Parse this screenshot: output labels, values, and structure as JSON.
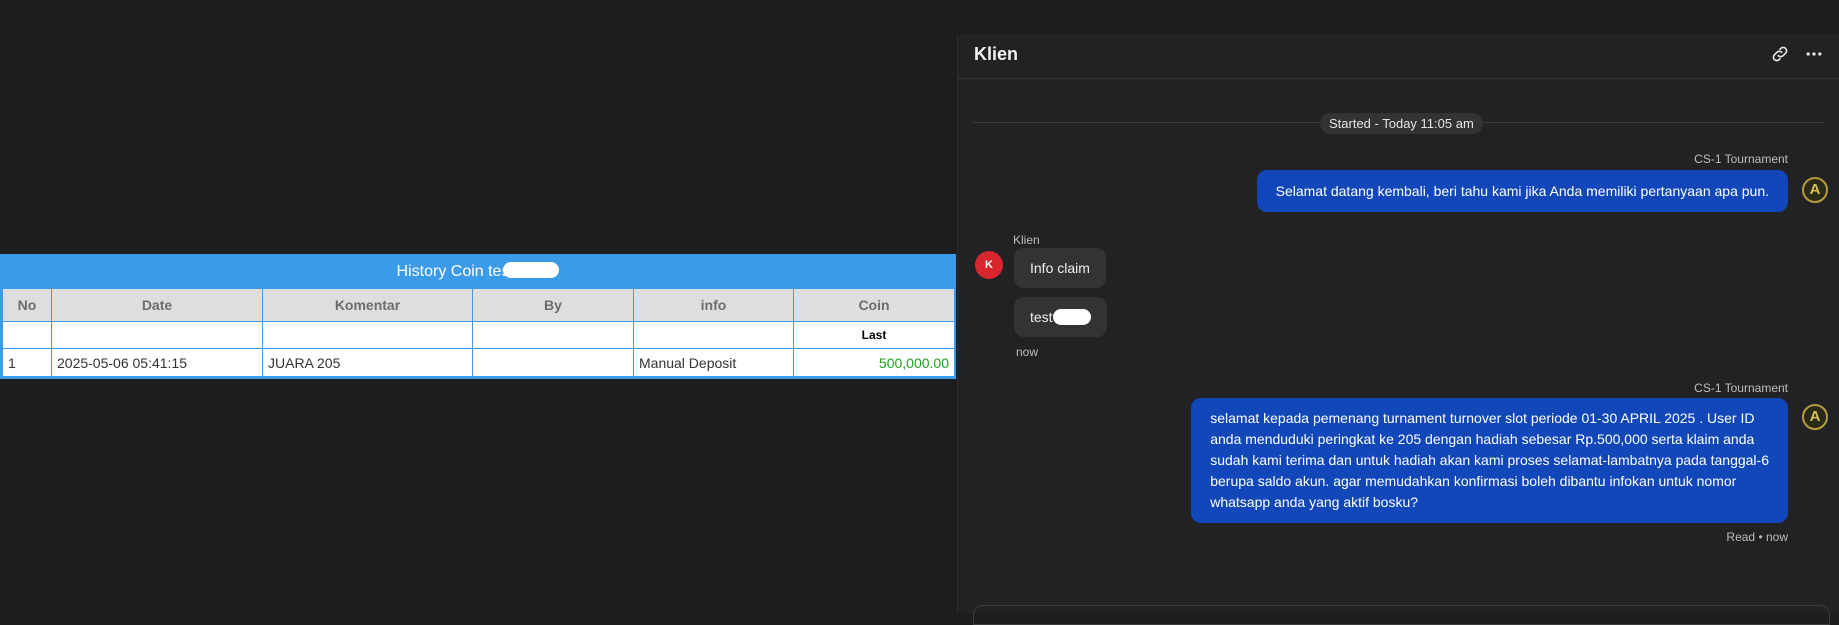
{
  "history": {
    "title": "History Coin tes",
    "columns": [
      "No",
      "Date",
      "Komentar",
      "By",
      "info",
      "Coin"
    ],
    "sub_label": "Last",
    "rows": [
      {
        "no": "1",
        "date": "2025-05-06 05:41:15",
        "komentar": "JUARA 205",
        "by": "",
        "info": "Manual Deposit",
        "coin": "500,000.00"
      }
    ]
  },
  "chat": {
    "title": "Klien",
    "started": "Started - Today 11:05 am",
    "agent_name": "CS-1 Tournament",
    "agent_avatar": "A",
    "messages": {
      "agent_1": "Selamat datang kembali, beri tahu kami jika Anda memiliki pertanyaan apa pun.",
      "client_label": "Klien",
      "client_avatar": "K",
      "client_1": "Info claim",
      "client_2": "test",
      "client_time": "now",
      "agent_2_lines": [
        "selamat kepada pemenang turnament turnover slot periode 01-30 APRIL 2025 . User ID",
        "anda menduduki peringkat ke 205 dengan hadiah sebesar Rp.500,000 serta klaim anda",
        "sudah kami terima dan untuk hadiah akan kami proses selamat-lambatnya pada tanggal-6",
        "berupa saldo akun. agar memudahkan konfirmasi boleh dibantu infokan untuk nomor",
        "whatsapp anda yang aktif bosku?"
      ],
      "read_status": "Read • now"
    },
    "icons": {
      "link": "link-icon",
      "more": "more-options-icon"
    },
    "colors": {
      "agent_bubble": "#1147b8",
      "client_bubble": "#333336",
      "table_accent": "#3b9be8",
      "coin": "#22a11f"
    }
  }
}
